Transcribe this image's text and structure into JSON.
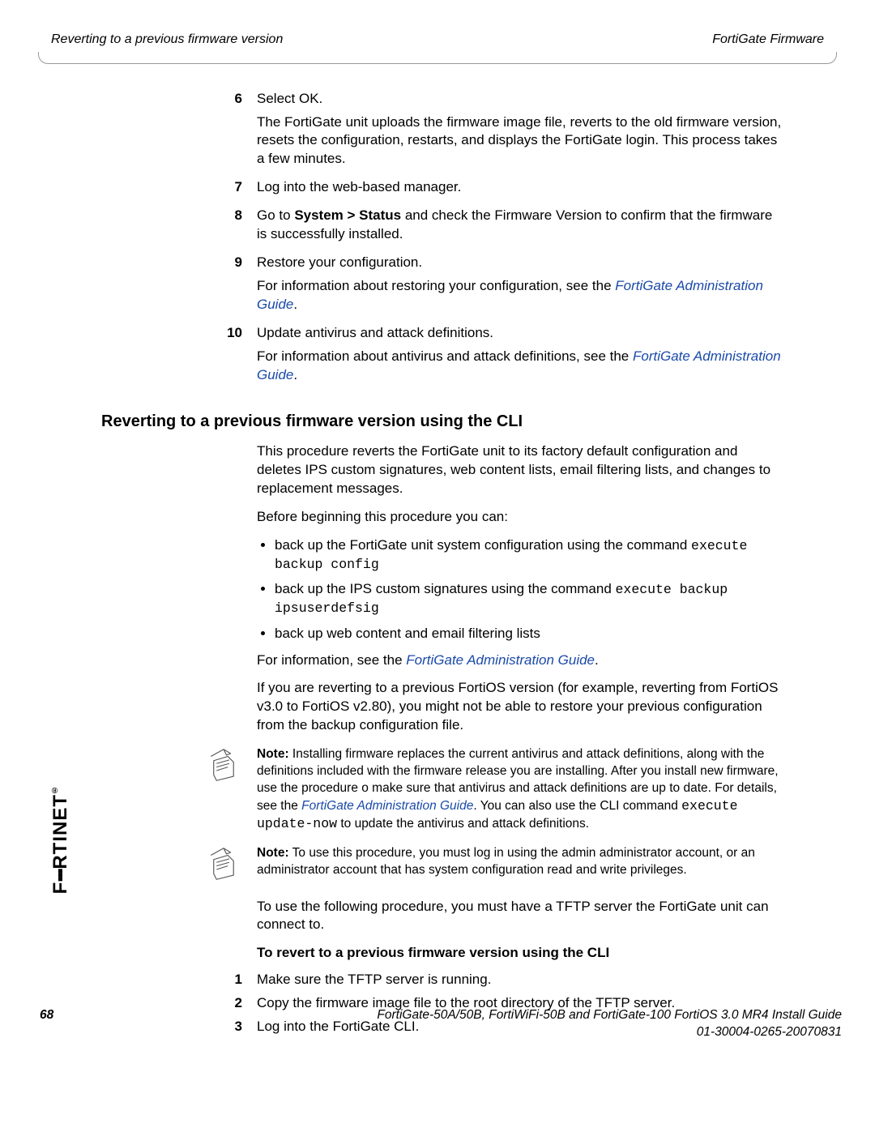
{
  "header": {
    "left": "Reverting to a previous firmware version",
    "right": "FortiGate Firmware"
  },
  "steps_a": [
    {
      "n": "6",
      "lines": [
        {
          "t": "Select OK."
        },
        {
          "t": "The FortiGate unit uploads the firmware image file, reverts to the old firmware version, resets the configuration, restarts, and displays the FortiGate login. This process takes a few minutes."
        }
      ]
    },
    {
      "n": "7",
      "lines": [
        {
          "t": "Log into the web-based manager."
        }
      ]
    },
    {
      "n": "8",
      "lines": [
        {
          "pre": "Go to ",
          "bold": "System > Status",
          "post": " and check the Firmware Version to confirm that the firmware is successfully installed."
        }
      ]
    },
    {
      "n": "9",
      "lines": [
        {
          "t": "Restore your configuration."
        },
        {
          "pre": "For information about restoring your configuration, see the ",
          "link": "FortiGate Administration Guide",
          "post": "."
        }
      ]
    },
    {
      "n": "10",
      "lines": [
        {
          "t": "Update antivirus and attack definitions."
        },
        {
          "pre": "For information about antivirus and attack definitions, see the ",
          "link": "FortiGate Administration Guide",
          "post": "."
        }
      ]
    }
  ],
  "section_title": "Reverting to a previous firmware version using the CLI",
  "intro1": "This procedure reverts the FortiGate unit to its factory default configuration and deletes IPS custom signatures, web content lists, email filtering lists, and changes to replacement messages.",
  "intro2": "Before beginning this procedure you can:",
  "bullets": [
    {
      "pre": "back up the FortiGate unit system configuration using the command ",
      "mono": "execute backup config"
    },
    {
      "pre": "back up the IPS custom signatures using the command ",
      "mono": "execute backup ipsuserdefsig"
    },
    {
      "pre": "back up web content and email filtering lists"
    }
  ],
  "afterbul": {
    "pre": "For information, see the ",
    "link": "FortiGate Administration Guide",
    "post": "."
  },
  "afterbul2": "If you are reverting to a previous FortiOS version (for example, reverting from FortiOS v3.0 to FortiOS v2.80), you might not be able to restore your previous configuration from the backup configuration file.",
  "note1": {
    "label": "Note:",
    "pre": " Installing firmware replaces the current antivirus and attack definitions, along with the definitions included with the firmware release you are installing. After you install new firmware, use the procedure o make sure that antivirus and attack definitions are up to date. For details, see the ",
    "link": "FortiGate Administration Guide",
    "mid": ". You can also use the CLI command ",
    "mono": "execute update-now",
    "post": " to update the antivirus and attack definitions."
  },
  "note2": {
    "label": "Note:",
    "body": " To use this procedure, you must log in using the admin administrator account, or an administrator account that has system configuration read and write privileges."
  },
  "afternotes": "To use the following procedure, you must have a TFTP server the FortiGate unit can connect to.",
  "proc_title": "To revert to a previous firmware version using the CLI",
  "steps_b": [
    {
      "n": "1",
      "t": "Make sure the TFTP server is running."
    },
    {
      "n": "2",
      "t": "Copy the firmware image file to the root directory of the TFTP server."
    },
    {
      "n": "3",
      "t": "Log into the FortiGate CLI."
    }
  ],
  "logo": "F RTINET",
  "footer": {
    "page": "68",
    "line1": "FortiGate-50A/50B, FortiWiFi-50B and FortiGate-100 FortiOS 3.0 MR4 Install Guide",
    "line2": "01-30004-0265-20070831"
  }
}
